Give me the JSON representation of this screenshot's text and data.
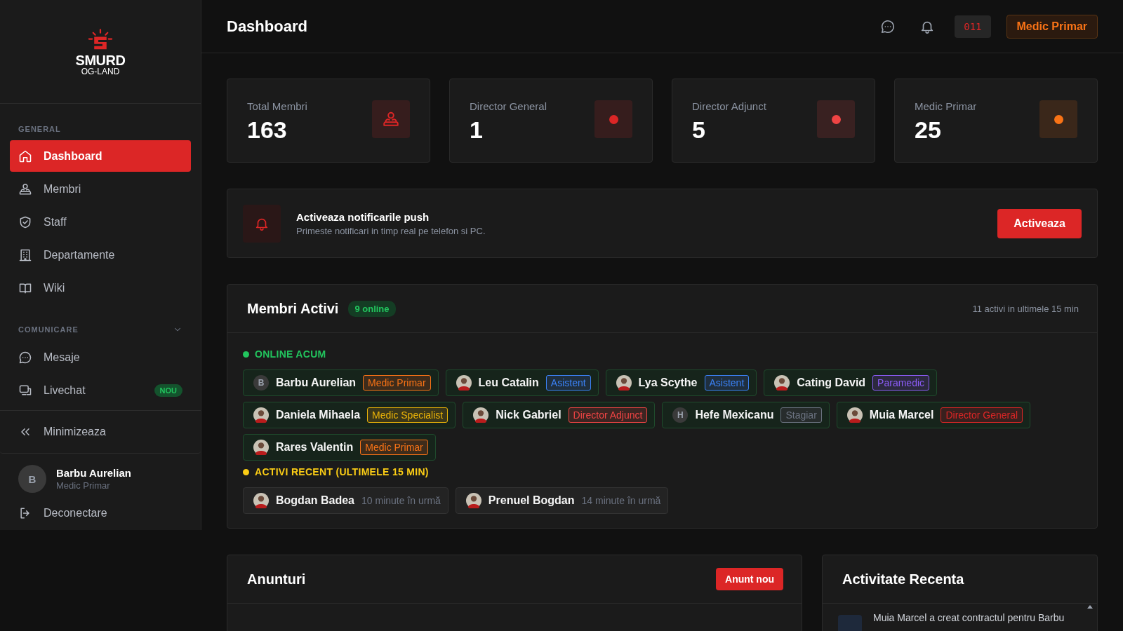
{
  "sidebar": {
    "logo": {
      "name": "SMURD",
      "sub": "OG-LAND"
    },
    "sections": [
      {
        "title": "GENERAL",
        "items": [
          {
            "label": "Dashboard",
            "selected": true
          },
          {
            "label": "Membri",
            "selected": false
          },
          {
            "label": "Staff",
            "selected": false
          },
          {
            "label": "Departamente",
            "selected": false
          },
          {
            "label": "Wiki",
            "selected": false
          }
        ]
      },
      {
        "title": "COMUNICARE",
        "expanded": true,
        "items": [
          {
            "label": "Mesaje",
            "selected": false
          },
          {
            "label": "Livechat",
            "selected": false,
            "badge": "NOU"
          }
        ]
      }
    ],
    "minimize": "Minimizeaza",
    "user": {
      "initial": "B",
      "name": "Barbu Aurelian",
      "role": "Medic Primar"
    },
    "logout": "Deconectare"
  },
  "header": {
    "title": "Dashboard",
    "code": "011",
    "role": "Medic Primar"
  },
  "stats": [
    {
      "label": "Total Membri",
      "value": "163",
      "kind": "icon",
      "color": "#dc2626"
    },
    {
      "label": "Director General",
      "value": "1",
      "kind": "dot",
      "color": "#dc2626"
    },
    {
      "label": "Director Adjunct",
      "value": "5",
      "kind": "dot",
      "color": "#ef4444"
    },
    {
      "label": "Medic Primar",
      "value": "25",
      "kind": "dot",
      "color": "#f97316"
    }
  ],
  "push": {
    "title": "Activeaza notificarile push",
    "text": "Primeste notificari in timp real pe telefon si PC.",
    "button": "Activeaza"
  },
  "active_members": {
    "title": "Membri Activi",
    "online_badge": "9 online",
    "summary": "11 activi in ultimele 15 min",
    "online_title": "ONLINE ACUM",
    "online": [
      {
        "name": "Barbu Aurelian",
        "initial": "B",
        "role": "Medic Primar",
        "color": "#f97316"
      },
      {
        "name": "Leu Catalin",
        "role": "Asistent",
        "color": "#3b82f6"
      },
      {
        "name": "Lya Scythe",
        "role": "Asistent",
        "color": "#3b82f6"
      },
      {
        "name": "Cating David",
        "role": "Paramedic",
        "color": "#8b5cf6"
      },
      {
        "name": "Daniela Mihaela",
        "role": "Medic Specialist",
        "color": "#eab308"
      },
      {
        "name": "Nick Gabriel",
        "role": "Director Adjunct",
        "color": "#ef4444"
      },
      {
        "name": "Hefe Mexicanu",
        "initial": "H",
        "role": "Stagiar",
        "color": "#6b7280"
      },
      {
        "name": "Muia Marcel",
        "role": "Director General",
        "color": "#dc2626"
      },
      {
        "name": "Rares Valentin",
        "role": "Medic Primar",
        "color": "#f97316"
      }
    ],
    "recent_title": "ACTIVI RECENT (ULTIMELE 15 MIN)",
    "recent": [
      {
        "name": "Bogdan Badea",
        "time": "10 minute în urmă"
      },
      {
        "name": "Prenuel Bogdan",
        "time": "14 minute în urmă"
      }
    ]
  },
  "announcements": {
    "title": "Anunturi",
    "button": "Anunt nou"
  },
  "activity": {
    "title": "Activitate Recenta",
    "items": [
      {
        "text": "Muia Marcel a creat contractul pentru Barbu"
      }
    ]
  }
}
